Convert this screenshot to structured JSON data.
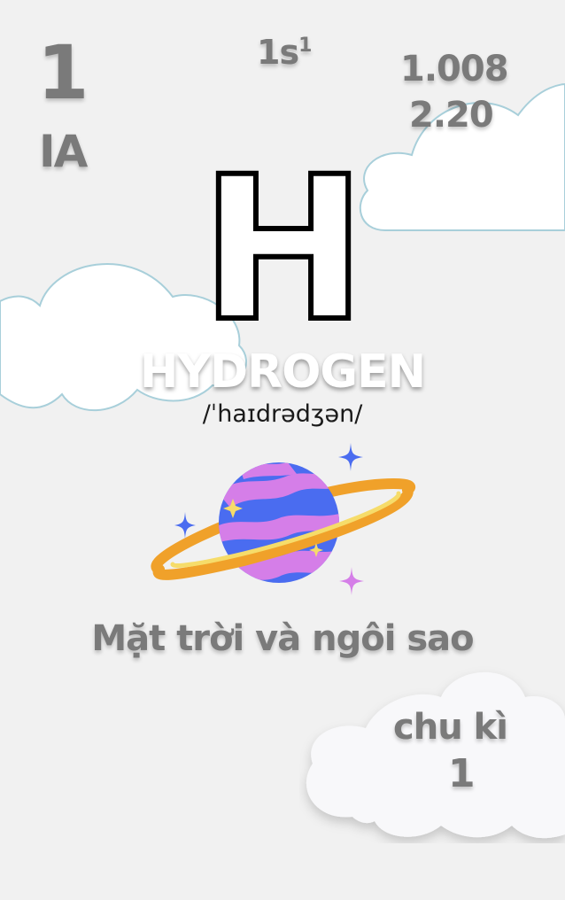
{
  "element": {
    "atomic_number": "1",
    "group": "IA",
    "configuration": "1s",
    "configuration_superscript": "1",
    "atomic_mass": "1.008",
    "electronegativity": "2.20",
    "symbol": "H",
    "name": "HYDROGEN",
    "pronunciation": "/ˈhaɪdrədʒən/",
    "description": "Mặt trời và ngôi sao",
    "period_label": "chu kì",
    "period_value": "1"
  },
  "icons": [
    "cloud-icon",
    "planet-icon",
    "sparkle-icon"
  ],
  "colors": {
    "background": "#f1f1f1",
    "grey_text": "#7a7a7a",
    "cloud_fill": "#ffffff",
    "cloud_outline": "#a8cfda",
    "planet_blue": "#4a6cf0",
    "planet_pink": "#d57ee8",
    "ring_orange": "#f0a12a",
    "ring_yellow": "#f6dc6a"
  }
}
